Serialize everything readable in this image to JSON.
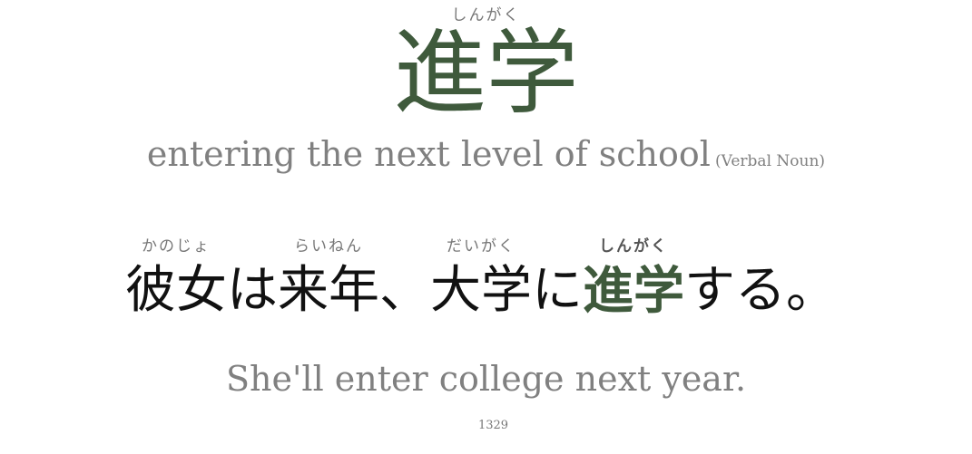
{
  "word": {
    "reading": "しんがく",
    "kanji": "進学"
  },
  "meaning": {
    "text": "entering the next level of school",
    "part_of_speech": "(Verbal Noun)"
  },
  "sentence": {
    "segments": [
      {
        "text": "彼女",
        "reading": "かのじょ"
      },
      {
        "text": "は",
        "reading": ""
      },
      {
        "text": "来年",
        "reading": "らいねん"
      },
      {
        "text": "、",
        "reading": ""
      },
      {
        "text": "大学",
        "reading": "だいがく"
      },
      {
        "text": "に",
        "reading": ""
      },
      {
        "text": "進学",
        "reading": "しんがく"
      },
      {
        "text": "する。",
        "reading": ""
      }
    ],
    "translation": "She'll enter college next year."
  },
  "card": {
    "id": "1329"
  },
  "colors": {
    "accent": "#3f5a3c",
    "muted": "#808080",
    "text": "#111111"
  }
}
